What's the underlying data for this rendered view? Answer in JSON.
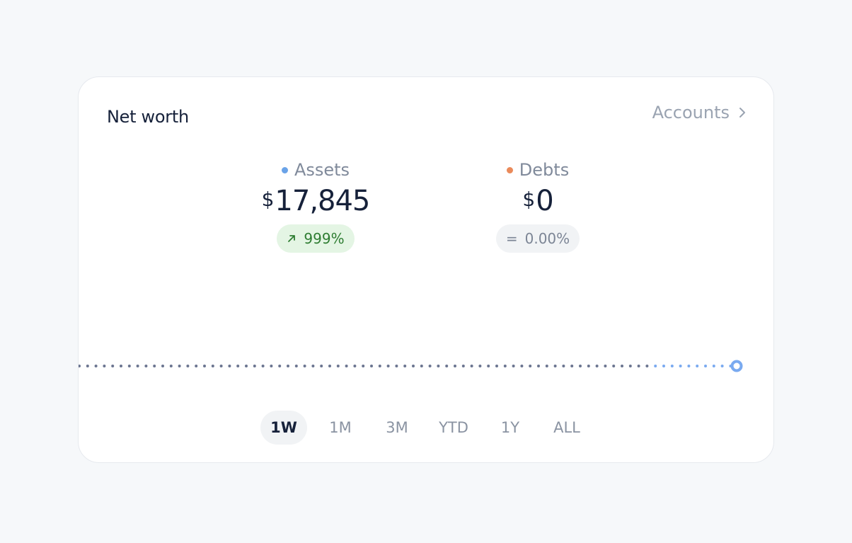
{
  "card": {
    "title": "Net worth",
    "accounts_link": "Accounts"
  },
  "assets": {
    "label": "Assets",
    "currency": "$",
    "value": "17,845",
    "change": "999%",
    "change_icon": "arrow-up-right-icon",
    "dot_color": "#6aa3e8"
  },
  "debts": {
    "label": "Debts",
    "currency": "$",
    "value": "0",
    "change_symbol": "=",
    "change": "0.00%",
    "dot_color": "#ea8a5a"
  },
  "range_tabs": [
    "1W",
    "1M",
    "3M",
    "YTD",
    "1Y",
    "ALL"
  ],
  "active_range": "1W",
  "colors": {
    "line_past": "#6b7590",
    "line_recent": "#7aaaf0",
    "positive": "#2e7d32"
  }
}
